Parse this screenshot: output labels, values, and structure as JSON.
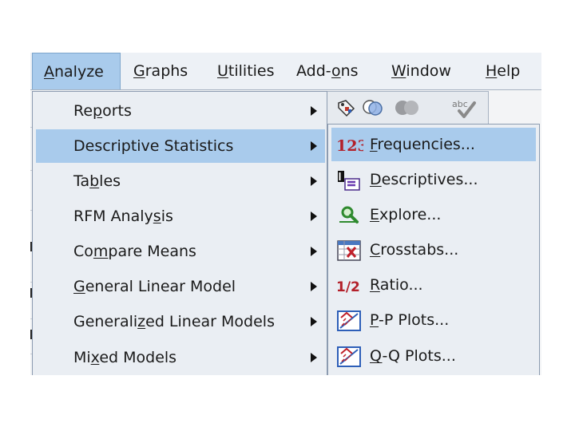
{
  "menubar": {
    "items": [
      {
        "label": "Analyze",
        "key": "A",
        "rest": "nalyze",
        "active": true
      },
      {
        "label": "Graphs",
        "key": "G",
        "rest": "raphs"
      },
      {
        "label": "Utilities",
        "key": "U",
        "rest": "tilities"
      },
      {
        "label": "Add-ons",
        "pre": "Add-",
        "key": "o",
        "rest": "ns"
      },
      {
        "label": "Window",
        "key": "W",
        "rest": "indow"
      },
      {
        "label": "Help",
        "key": "H",
        "rest": "elp"
      }
    ]
  },
  "toolbar": {
    "icons": [
      "tag-icon",
      "circles-icon",
      "gray-circles-icon",
      "spellcheck-icon"
    ],
    "spellcheck_text": "abc"
  },
  "analyze_menu": {
    "items": [
      {
        "pre": "Re",
        "key": "p",
        "rest": "orts"
      },
      {
        "pre": "Descriptive Statistics",
        "key": "",
        "rest": "",
        "highlighted": true
      },
      {
        "pre": "Ta",
        "key": "b",
        "rest": "les"
      },
      {
        "pre": "RFM Analy",
        "key": "s",
        "rest": "is"
      },
      {
        "pre": "Co",
        "key": "m",
        "rest": "pare Means"
      },
      {
        "pre": "",
        "key": "G",
        "rest": "eneral Linear Model"
      },
      {
        "pre": "Generali",
        "key": "z",
        "rest": "ed Linear Models"
      },
      {
        "pre": "Mi",
        "key": "x",
        "rest": "ed Models"
      }
    ]
  },
  "descriptive_submenu": {
    "items": [
      {
        "pre": "",
        "key": "F",
        "rest": "requencies...",
        "icon": "frequencies-123-icon",
        "icon_text": "123",
        "highlighted": true
      },
      {
        "pre": "",
        "key": "D",
        "rest": "escriptives...",
        "icon": "descriptives-mu-sigma-icon"
      },
      {
        "pre": "",
        "key": "E",
        "rest": "xplore...",
        "icon": "explore-magnifier-icon"
      },
      {
        "pre": "",
        "key": "C",
        "rest": "rosstabs...",
        "icon": "crosstabs-table-icon"
      },
      {
        "pre": "",
        "key": "R",
        "rest": "atio...",
        "icon": "ratio-half-icon",
        "icon_text": "1/2"
      },
      {
        "pre": "",
        "key": "P",
        "rest": "-P Plots...",
        "icon": "pp-plot-icon"
      },
      {
        "pre": "",
        "key": "Q",
        "rest": "-Q Plots...",
        "icon": "qq-plot-icon"
      }
    ]
  },
  "colors": {
    "highlight": "#a9cbec",
    "menu_bg": "#eaeef3",
    "border": "#8c9bb0"
  }
}
